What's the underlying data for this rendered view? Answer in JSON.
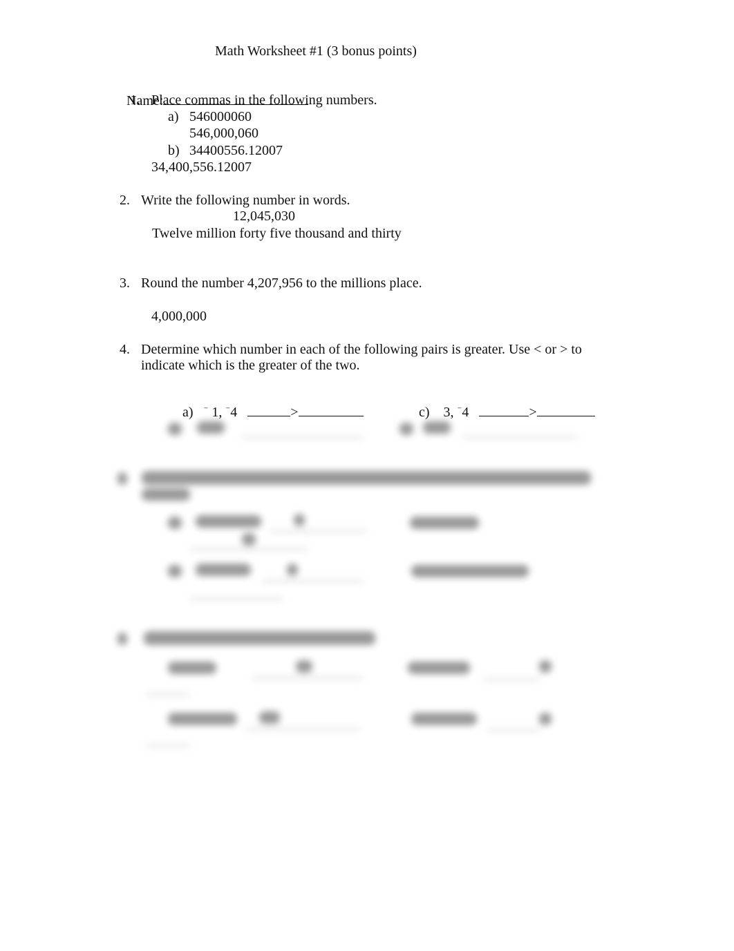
{
  "document": {
    "title": "Math Worksheet #1 (3 bonus points)",
    "name_label": "Name:",
    "questions": [
      {
        "number": "1.",
        "prompt": "Place commas in the following numbers.",
        "parts": [
          {
            "label": "a)",
            "given": "546000060",
            "answer": "546,000,060"
          },
          {
            "label": "b)",
            "given": "34400556.12007",
            "answer": "34,400,556.12007"
          }
        ]
      },
      {
        "number": "2.",
        "prompt": "Write the following number in words.",
        "given": "12,045,030",
        "answer": "Twelve million forty five thousand and thirty"
      },
      {
        "number": "3.",
        "prompt": "Round the number 4,207,956 to the millions place.",
        "answer": "4,000,000"
      },
      {
        "number": "4.",
        "prompt_line1": "Determine which number in each of the following pairs is greater. Use < or > to",
        "prompt_line2": "indicate which is the greater of the two.",
        "parts": [
          {
            "label": "a)",
            "sign1": "⁻",
            "v1": " 1, ",
            "sign2": "⁻",
            "v2": "4",
            "answer_symbol": ">"
          },
          {
            "label": "c)",
            "v1": "3, ",
            "sign2": "⁻",
            "v2": "4",
            "answer_symbol": ">"
          }
        ]
      }
    ],
    "blurred_notice": "remaining content blurred"
  }
}
